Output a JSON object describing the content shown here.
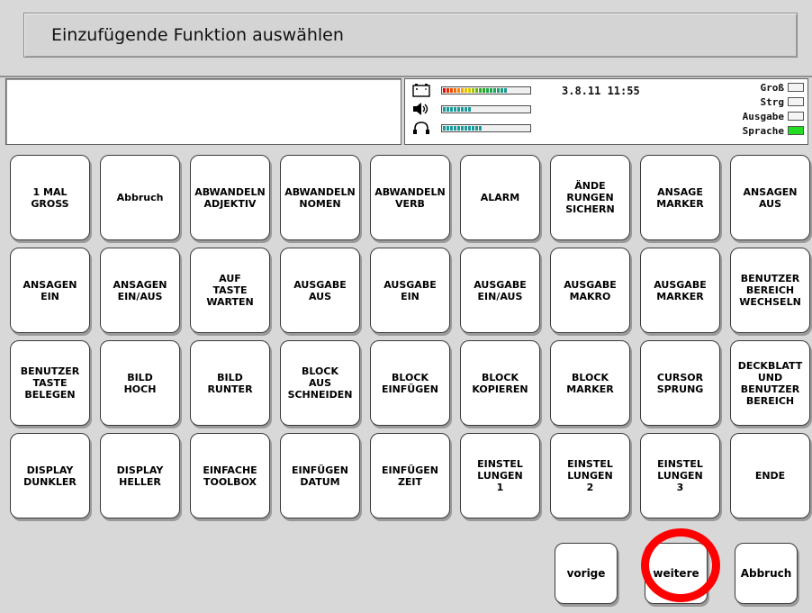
{
  "title": "Einzufügende Funktion auswählen",
  "text_area": "",
  "status": {
    "datetime": "3.8.11 11:55",
    "battery_level": 0.72,
    "volume_level": 0.32,
    "headphone_level": 0.45,
    "indicators": [
      {
        "label": "Groß",
        "active": false
      },
      {
        "label": "Strg",
        "active": false
      },
      {
        "label": "Ausgabe",
        "active": false
      },
      {
        "label": "Sprache",
        "active": true
      }
    ],
    "colors": {
      "battery": "#ff8800",
      "level": "#1a9a9a",
      "active": "#22dd22"
    }
  },
  "grid": [
    [
      "1 MAL\nGROSS",
      "Abbruch",
      "ABWANDELN\nADJEKTIV",
      "ABWANDELN\nNOMEN",
      "ABWANDELN\nVERB",
      "ALARM",
      "ÄNDE\nRUNGEN\nSICHERN",
      "ANSAGE\nMARKER",
      "ANSAGEN\nAUS"
    ],
    [
      "ANSAGEN\nEIN",
      "ANSAGEN\nEIN/AUS",
      "AUF\nTASTE\nWARTEN",
      "AUSGABE\nAUS",
      "AUSGABE\nEIN",
      "AUSGABE\nEIN/AUS",
      "AUSGABE\nMAKRO",
      "AUSGABE\nMARKER",
      "BENUTZER\nBEREICH\nWECHSELN"
    ],
    [
      "BENUTZER\nTASTE\nBELEGEN",
      "BILD\nHOCH",
      "BILD\nRUNTER",
      "BLOCK\nAUS\nSCHNEIDEN",
      "BLOCK\nEINFÜGEN",
      "BLOCK\nKOPIEREN",
      "BLOCK\nMARKER",
      "CURSOR\nSPRUNG",
      "DECKBLATT\nUND\nBENUTZER\nBEREICH"
    ],
    [
      "DISPLAY\nDUNKLER",
      "DISPLAY\nHELLER",
      "EINFACHE\nTOOLBOX",
      "EINFÜGEN\nDATUM",
      "EINFÜGEN\nZEIT",
      "EINSTEL\nLUNGEN\n1",
      "EINSTEL\nLUNGEN\n2",
      "EINSTEL\nLUNGEN\n3",
      "ENDE"
    ]
  ],
  "nav": {
    "prev": "vorige",
    "next": "weitere",
    "cancel": "Abbruch"
  }
}
